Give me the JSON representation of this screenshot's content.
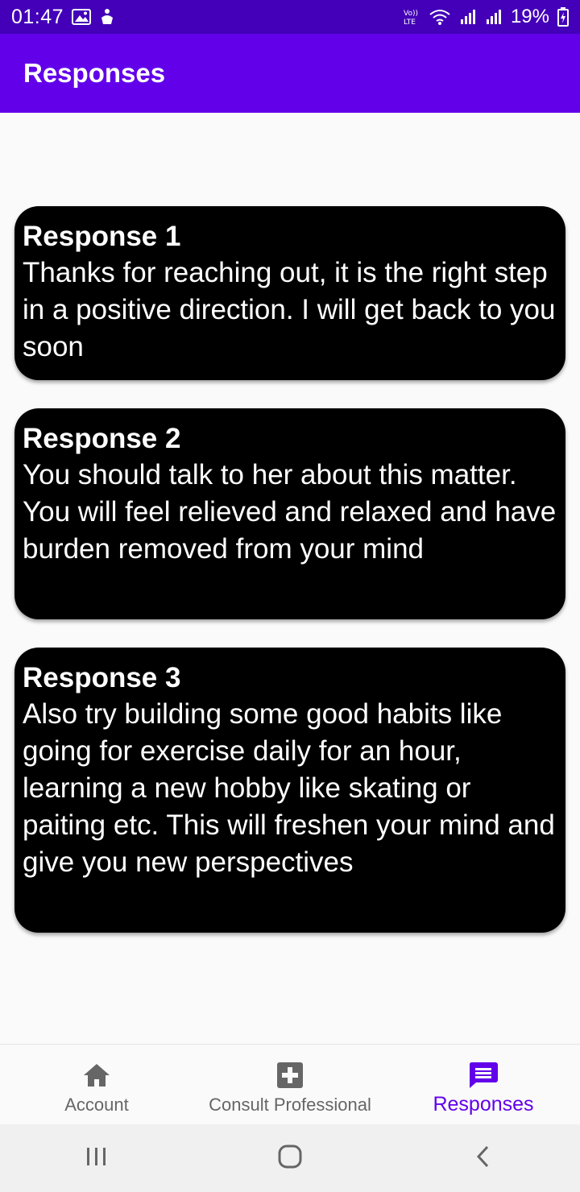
{
  "status_bar": {
    "time": "01:47",
    "battery": "19%",
    "icons": [
      "gallery-icon",
      "notification-icon",
      "volte-icon",
      "wifi-icon",
      "signal-icon",
      "signal-icon",
      "battery-charging-icon"
    ]
  },
  "app_bar": {
    "title": "Responses"
  },
  "responses": [
    {
      "title": "Response 1",
      "body": "Thanks for reaching out, it is the right step in a positive direction. I will get back to you soon"
    },
    {
      "title": "Response 2",
      "body": "You should talk to her about this matter. You will feel relieved and relaxed and have burden removed from your mind"
    },
    {
      "title": "Response 3",
      "body": "Also try building some good habits like going for exercise daily for an hour, learning a new hobby like skating or paiting etc. This will freshen your mind and give you new perspectives"
    }
  ],
  "bottom_nav": {
    "items": [
      {
        "label": "Account",
        "icon": "home-icon",
        "active": false
      },
      {
        "label": "Consult Professional",
        "icon": "medical-plus-icon",
        "active": false
      },
      {
        "label": "Responses",
        "icon": "chat-message-icon",
        "active": true
      }
    ]
  },
  "system_nav": {
    "icons": [
      "recents-icon",
      "home-circle-icon",
      "back-icon"
    ]
  },
  "colors": {
    "status_bar": "#4300b8",
    "app_bar": "#6200ea",
    "active_tab": "#6200ea",
    "inactive_tab": "#666666",
    "card_bg": "#000000",
    "card_text": "#ffffff"
  }
}
